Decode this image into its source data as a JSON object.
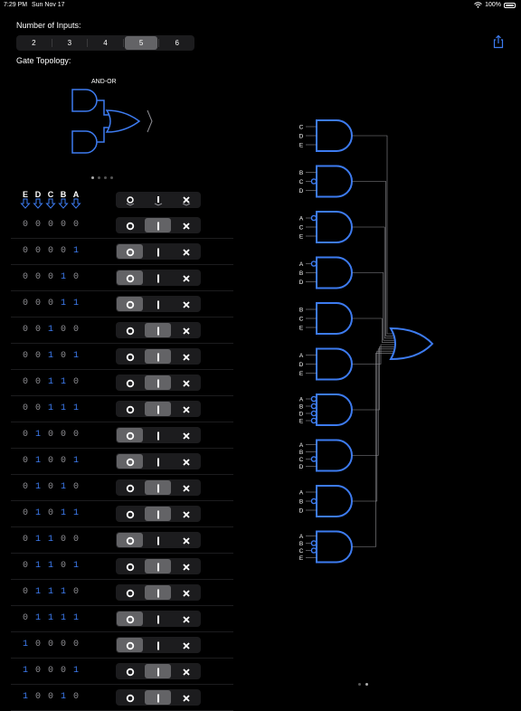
{
  "status_bar": {
    "time": "7:29 PM",
    "date": "Sun Nov 17",
    "battery": "100%"
  },
  "inputs": {
    "label": "Number of Inputs:",
    "options": [
      "2",
      "3",
      "4",
      "5",
      "6"
    ],
    "selected": "5"
  },
  "topology": {
    "label": "Gate Topology:",
    "name": "AND-OR"
  },
  "topology_pager": {
    "count": 4,
    "active": 0
  },
  "truth_table": {
    "headers": [
      "E",
      "D",
      "C",
      "B",
      "A"
    ],
    "header_arrow_icon": "arrow-down-icon",
    "control_icons": [
      "circle-icon",
      "bar-icon",
      "x-icon"
    ],
    "rows": [
      {
        "bits": "00000",
        "sel": 1
      },
      {
        "bits": "00001",
        "sel": 0
      },
      {
        "bits": "00010",
        "sel": 0
      },
      {
        "bits": "00011",
        "sel": 0
      },
      {
        "bits": "00100",
        "sel": 1
      },
      {
        "bits": "00101",
        "sel": 1
      },
      {
        "bits": "00110",
        "sel": 1
      },
      {
        "bits": "00111",
        "sel": 1
      },
      {
        "bits": "01000",
        "sel": 0
      },
      {
        "bits": "01001",
        "sel": 0
      },
      {
        "bits": "01010",
        "sel": 1
      },
      {
        "bits": "01011",
        "sel": 1
      },
      {
        "bits": "01100",
        "sel": 0
      },
      {
        "bits": "01101",
        "sel": 1
      },
      {
        "bits": "01110",
        "sel": 1
      },
      {
        "bits": "01111",
        "sel": 0
      },
      {
        "bits": "10000",
        "sel": 0
      },
      {
        "bits": "10001",
        "sel": 1
      },
      {
        "bits": "10010",
        "sel": 1
      }
    ]
  },
  "circuit": {
    "gates": [
      {
        "inputs": [
          {
            "n": "C",
            "neg": false
          },
          {
            "n": "D",
            "neg": false
          },
          {
            "n": "E",
            "neg": false
          }
        ]
      },
      {
        "inputs": [
          {
            "n": "B",
            "neg": false
          },
          {
            "n": "C",
            "neg": true
          },
          {
            "n": "D",
            "neg": false
          }
        ]
      },
      {
        "inputs": [
          {
            "n": "A",
            "neg": true
          },
          {
            "n": "C",
            "neg": false
          },
          {
            "n": "E",
            "neg": false
          }
        ]
      },
      {
        "inputs": [
          {
            "n": "A",
            "neg": true
          },
          {
            "n": "B",
            "neg": false
          },
          {
            "n": "D",
            "neg": false
          }
        ]
      },
      {
        "inputs": [
          {
            "n": "B",
            "neg": false
          },
          {
            "n": "C",
            "neg": false
          },
          {
            "n": "E",
            "neg": false
          }
        ]
      },
      {
        "inputs": [
          {
            "n": "A",
            "neg": false
          },
          {
            "n": "D",
            "neg": false
          },
          {
            "n": "E",
            "neg": false
          }
        ]
      },
      {
        "inputs": [
          {
            "n": "A",
            "neg": true
          },
          {
            "n": "B",
            "neg": true
          },
          {
            "n": "D",
            "neg": true
          },
          {
            "n": "E",
            "neg": true
          }
        ]
      },
      {
        "inputs": [
          {
            "n": "A",
            "neg": false
          },
          {
            "n": "B",
            "neg": false
          },
          {
            "n": "C",
            "neg": true
          },
          {
            "n": "D",
            "neg": false
          }
        ]
      },
      {
        "inputs": [
          {
            "n": "A",
            "neg": false
          },
          {
            "n": "B",
            "neg": true
          },
          {
            "n": "D",
            "neg": false
          }
        ]
      },
      {
        "inputs": [
          {
            "n": "A",
            "neg": false
          },
          {
            "n": "B",
            "neg": true
          },
          {
            "n": "C",
            "neg": true
          },
          {
            "n": "E",
            "neg": false
          }
        ]
      }
    ]
  },
  "page_indicator": {
    "count": 2,
    "active": 1
  },
  "colors": {
    "accent": "#3d7bf0",
    "wire": "#8e8e93",
    "zero": "#8e8e93",
    "one": "#3d7bf0"
  }
}
